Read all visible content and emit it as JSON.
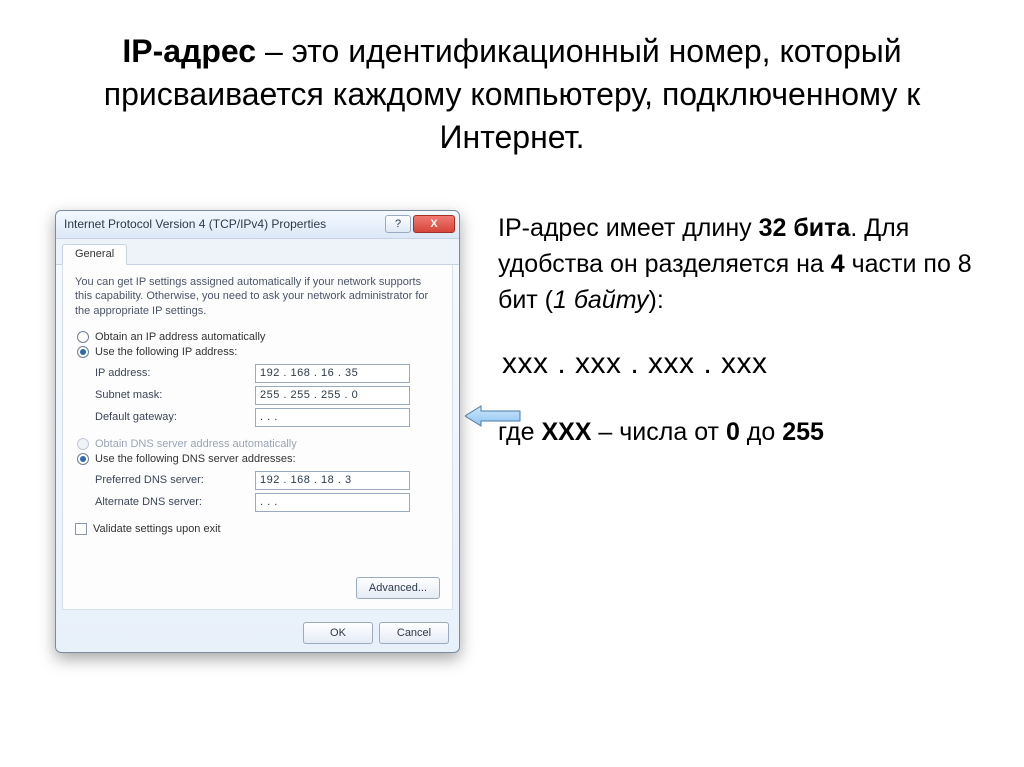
{
  "heading": {
    "term": "IP-адрес",
    "rest": " – это идентификационный номер, который присваивается каждому компьютеру, подключенному к Интернет."
  },
  "dialog": {
    "title": "Internet Protocol Version 4 (TCP/IPv4) Properties",
    "help_icon": "?",
    "close_icon": "X",
    "tab": "General",
    "desc": "You can get IP settings assigned automatically if your network supports this capability. Otherwise, you need to ask your network administrator for the appropriate IP settings.",
    "radio_auto_ip": "Obtain an IP address automatically",
    "radio_manual_ip": "Use the following IP address:",
    "ip_label": "IP address:",
    "ip_value": "192 . 168 . 16 . 35",
    "mask_label": "Subnet mask:",
    "mask_value": "255 . 255 . 255 . 0",
    "gw_label": "Default gateway:",
    "gw_value": ".       .       .",
    "radio_auto_dns": "Obtain DNS server address automatically",
    "radio_manual_dns": "Use the following DNS server addresses:",
    "pdns_label": "Preferred DNS server:",
    "pdns_value": "192 . 168 . 18 .  3",
    "adns_label": "Alternate DNS server:",
    "adns_value": ".       .       .",
    "validate": "Validate settings upon exit",
    "advanced": "Advanced...",
    "ok": "OK",
    "cancel": "Cancel"
  },
  "right": {
    "line1_a": "IP-адрес имеет длину ",
    "line1_b": "32 бита",
    "line1_c": ". Для удобства он разделяется на ",
    "line1_d": "4",
    "line1_e": " части по 8 бит (",
    "line1_f": "1 байту",
    "line1_g": "):",
    "xxx": "ххх . ххх . ххх . ххх",
    "line2_a": "где ",
    "line2_b": "ХХХ",
    "line2_c": " – числа от ",
    "line2_d": "0",
    "line2_e": " до ",
    "line2_f": "255"
  }
}
